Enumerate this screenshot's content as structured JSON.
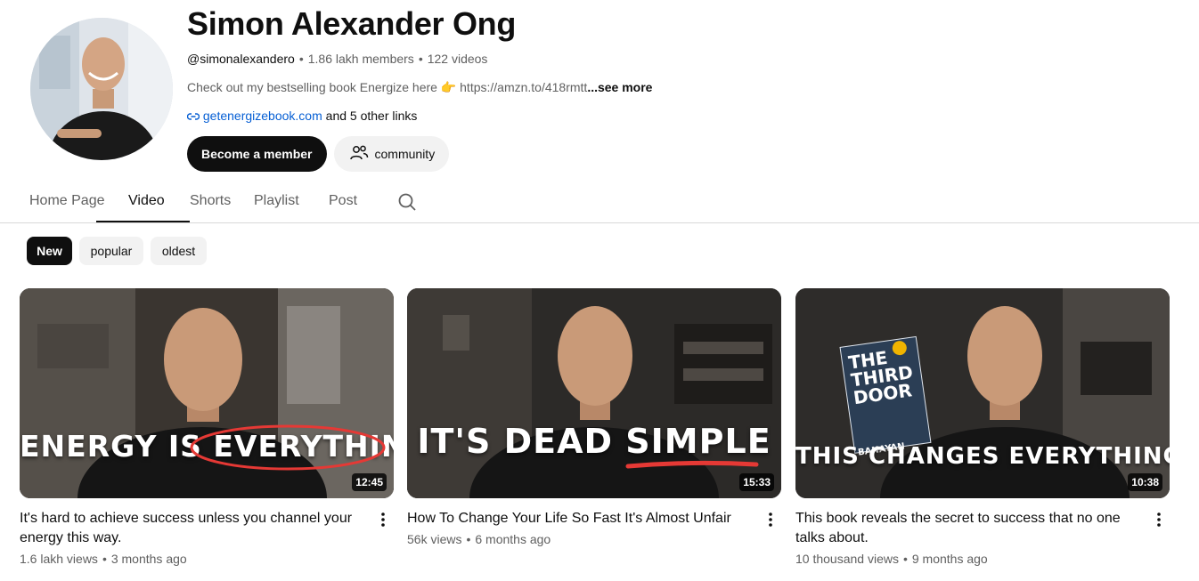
{
  "channel": {
    "name": "Simon Alexander Ong",
    "handle": "@simonalexandero",
    "members": "1.86 lakh members",
    "videos": "122 videos",
    "description": "Check out my bestselling book Energize here 👉 https://amzn.to/418rmtt",
    "see_more": "...see more",
    "link_text": "getenergizebook.com",
    "other_links": "and 5 other links",
    "member_button": "Become a member",
    "community_button": "community"
  },
  "tabs": [
    "Home Page",
    "Video",
    "Shorts",
    "Playlist",
    "Post"
  ],
  "active_tab": "Video",
  "chips": [
    "New",
    "popular",
    "oldest"
  ],
  "active_chip": "New",
  "videos": [
    {
      "thumb_text": "ENERGY IS EVERYTHING",
      "duration": "12:45",
      "title": "It's hard to achieve success unless you channel your energy this way.",
      "views": "1.6 lakh views",
      "age": "3 months ago"
    },
    {
      "thumb_text": "IT'S DEAD SIMPLE",
      "duration": "15:33",
      "title": "How To Change Your Life So Fast It's Almost Unfair",
      "views": "56k views",
      "age": "6 months ago"
    },
    {
      "thumb_text": "THIS CHANGES EVERYTHING",
      "book_title": "THE THIRD DOOR",
      "book_author": "BANAYAN",
      "duration": "10:38",
      "title": "This book reveals the secret to success that no one talks about.",
      "views": "10 thousand views",
      "age": "9 months ago"
    }
  ],
  "colors": {
    "text_primary": "#0f0f0f",
    "text_secondary": "#606060",
    "link": "#065fd4",
    "chip_bg": "#f2f2f2",
    "accent_red": "#e53935"
  }
}
